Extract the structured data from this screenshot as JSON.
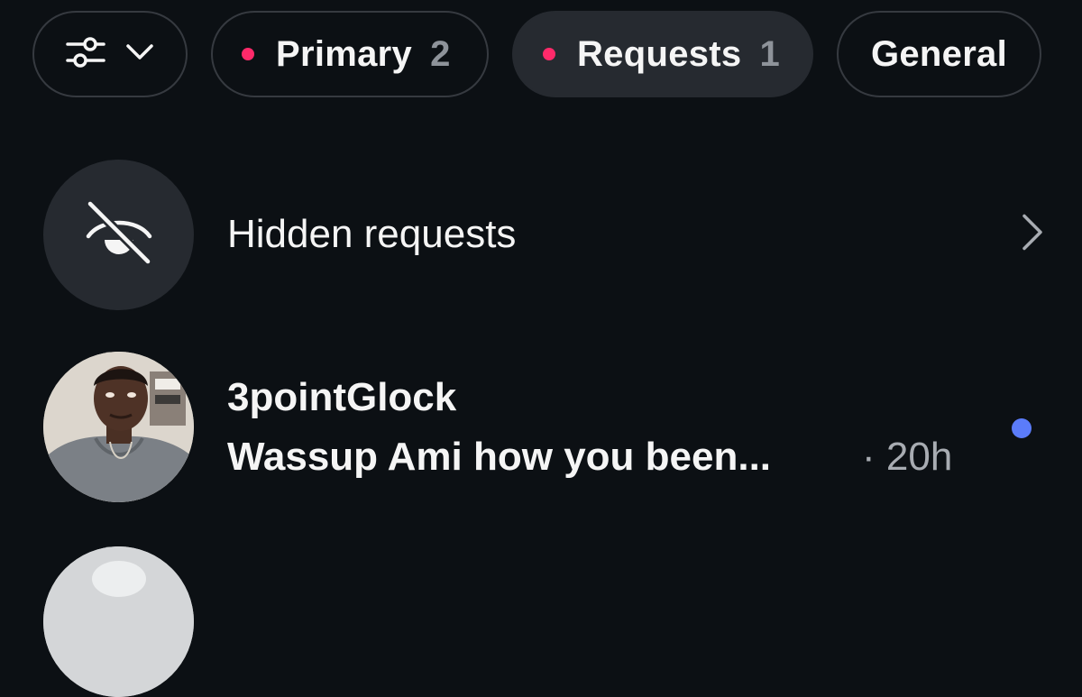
{
  "filters": {
    "filter_button": {
      "icon": "sliders-icon",
      "dropdown_icon": "chevron-down-icon"
    },
    "tabs": [
      {
        "label": "Primary",
        "count": "2",
        "has_dot": true,
        "active": false
      },
      {
        "label": "Requests",
        "count": "1",
        "has_dot": true,
        "active": true
      },
      {
        "label": "General",
        "count": "",
        "has_dot": false,
        "active": false
      }
    ]
  },
  "hidden_requests": {
    "label": "Hidden requests",
    "icon": "eye-slash-icon",
    "chevron_icon": "chevron-right-icon"
  },
  "messages": [
    {
      "sender": "3pointGlock",
      "preview": "Wassup Ami how you been...",
      "time": "· 20h",
      "unread": true
    }
  ],
  "colors": {
    "background": "#0c1014",
    "chip_border": "#363a40",
    "chip_active": "#262a30",
    "notification_dot": "#ff2a6a",
    "unread_dot": "#5b7cfa",
    "muted_text": "#8e939a"
  }
}
